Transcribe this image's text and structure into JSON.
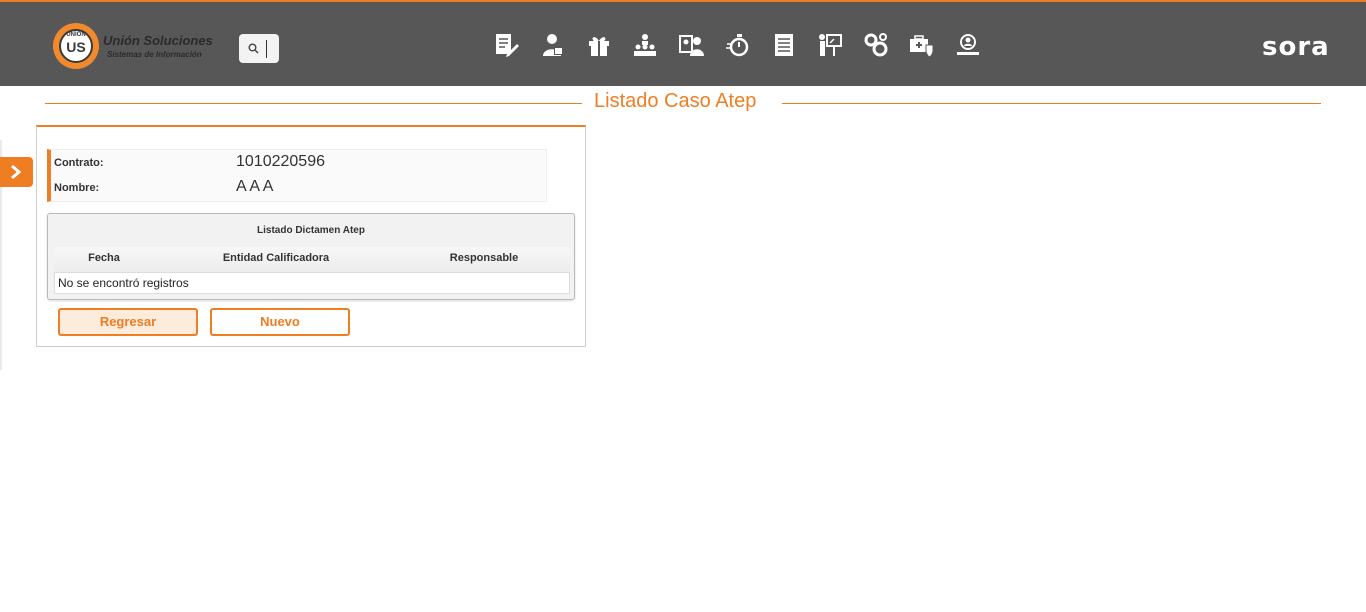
{
  "header": {
    "logo": {
      "mark_small": "UNION",
      "mark": "US",
      "line1": "Unión Soluciones",
      "line2": "Sistemas de Información"
    },
    "search": {
      "icon": "search-icon"
    },
    "nav_icons": [
      "document-edit-icon",
      "user-badge-icon",
      "gift-icon",
      "org-hierarchy-icon",
      "user-card-icon",
      "stopwatch-icon",
      "report-sheet-icon",
      "presentation-icon",
      "gears-icon",
      "medical-briefcase-icon",
      "user-search-icon"
    ],
    "brand": "sora",
    "accent_color": "#ef7d22",
    "bar_color": "#575757"
  },
  "page": {
    "title": "Listado Caso Atep"
  },
  "info": {
    "contrato_label": "Contrato:",
    "contrato_value": "1010220596",
    "nombre_label": "Nombre:",
    "nombre_value": "A A A"
  },
  "table": {
    "caption": "Listado Dictamen Atep",
    "columns": [
      "Fecha",
      "Entidad Calificadora",
      "Responsable"
    ],
    "empty_message": "No se encontró registros"
  },
  "buttons": {
    "back": "Regresar",
    "new": "Nuevo"
  }
}
